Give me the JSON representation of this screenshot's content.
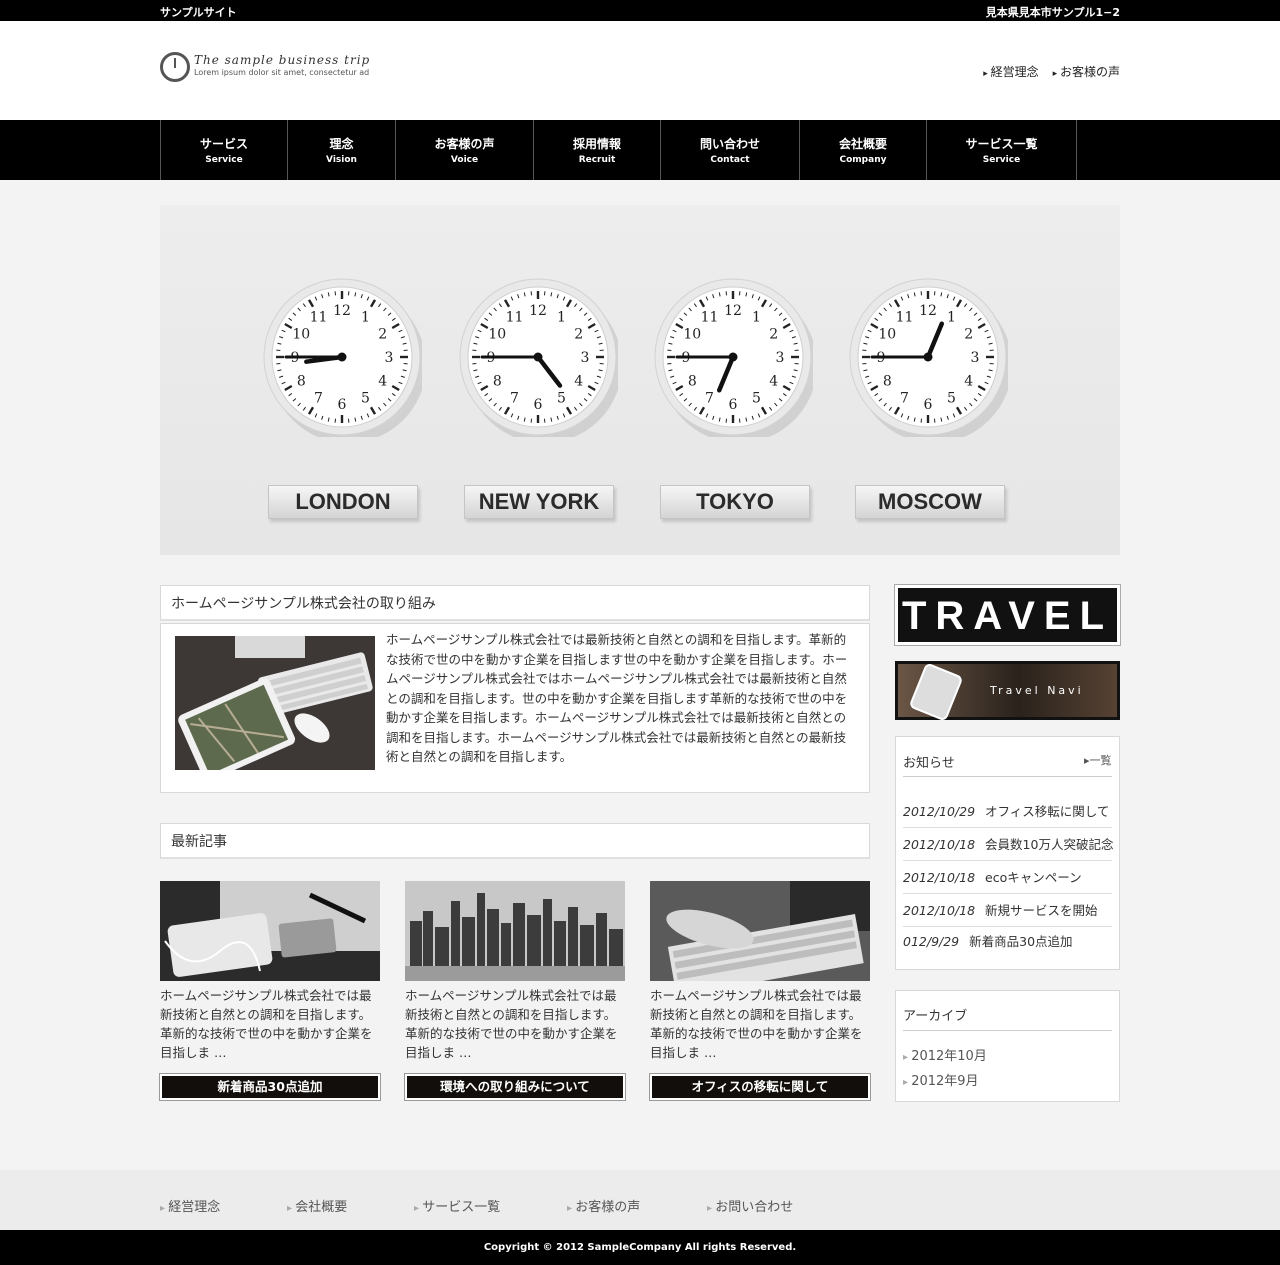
{
  "topbar": {
    "site_name": "サンプルサイト",
    "address": "見本県見本市サンプル1−2"
  },
  "logo": {
    "title": "The sample business trip",
    "tagline": "Lorem ipsum dolor sit amet, consectetur ad"
  },
  "header_links": [
    "経営理念",
    "お客様の声"
  ],
  "nav": [
    {
      "ja": "サービス",
      "en": "Service"
    },
    {
      "ja": "理念",
      "en": "Vision"
    },
    {
      "ja": "お客様の声",
      "en": "Voice"
    },
    {
      "ja": "採用情報",
      "en": "Recruit"
    },
    {
      "ja": "問い合わせ",
      "en": "Contact"
    },
    {
      "ja": "会社概要",
      "en": "Company"
    },
    {
      "ja": "サービス一覧",
      "en": "Service"
    }
  ],
  "hero": {
    "clocks": [
      {
        "city": "LONDON",
        "hour": 8,
        "minute": 45
      },
      {
        "city": "NEW YORK",
        "hour": 4,
        "minute": 45
      },
      {
        "city": "TOKYO",
        "hour": 6,
        "minute": 45
      },
      {
        "city": "MOSCOW",
        "hour": 12,
        "minute": 45
      }
    ]
  },
  "intro": {
    "heading": "ホームページサンプル株式会社の取り組み",
    "body": "ホームページサンプル株式会社では最新技術と自然との調和を目指します。革新的な技術で世の中を動かす企業を目指します世の中を動かす企業を目指します。ホームページサンプル株式会社ではホームページサンプル株式会社では最新技術と自然との調和を目指します。世の中を動かす企業を目指します革新的な技術で世の中を動かす企業を目指します。ホームページサンプル株式会社では最新技術と自然との調和を目指します。ホームページサンプル株式会社では最新技術と自然との最新技術と自然との調和を目指します。"
  },
  "recent": {
    "heading": "最新記事",
    "articles": [
      {
        "excerpt": "ホームページサンプル株式会社では最新技術と自然との調和を目指します。革新的な技術で世の中を動かす企業を目指しま …",
        "button": "新着商品30点追加"
      },
      {
        "excerpt": "ホームページサンプル株式会社では最新技術と自然との調和を目指します。革新的な技術で世の中を動かす企業を目指しま …",
        "button": "環境への取り組みについて"
      },
      {
        "excerpt": "ホームページサンプル株式会社では最新技術と自然との調和を目指します。革新的な技術で世の中を動かす企業を目指しま …",
        "button": "オフィスの移転に関して"
      }
    ]
  },
  "sidebar": {
    "banner1": "TRAVEL",
    "banner2": "Travel Navi",
    "news": {
      "title": "お知らせ",
      "more": "一覧",
      "items": [
        {
          "date": "2012/10/29",
          "text": "オフィス移転に関して"
        },
        {
          "date": "2012/10/18",
          "text": "会員数10万人突破記念"
        },
        {
          "date": "2012/10/18",
          "text": "ecoキャンペーン"
        },
        {
          "date": "2012/10/18",
          "text": "新規サービスを開始"
        },
        {
          "date": "012/9/29",
          "text": "新着商品30点追加"
        }
      ]
    },
    "archive": {
      "title": "アーカイブ",
      "items": [
        "2012年10月",
        "2012年9月"
      ]
    }
  },
  "footer": {
    "links": [
      "経営理念",
      "会社概要",
      "サービス一覧",
      "お客様の声",
      "お問い合わせ"
    ],
    "copyright": "Copyright © 2012 SampleCompany All rights Reserved."
  }
}
